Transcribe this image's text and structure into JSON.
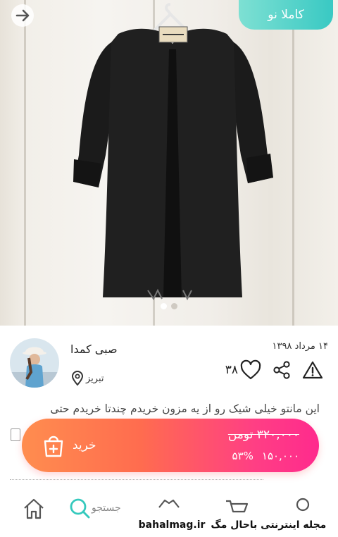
{
  "product": {
    "condition_badge": "کاملا نو",
    "description": "این مانتو خیلی شیک رو از یه مزون خریدم چندتا خریدم حتی",
    "date": "۱۴ مرداد ۱۳۹۸"
  },
  "seller": {
    "name": "صبی کمدا",
    "location": "تبریز"
  },
  "stats": {
    "likes": "۳۸"
  },
  "buy": {
    "label": "خرید",
    "price_original": "۳۲۰,۰۰۰ تومن",
    "price_final": "۱۵۰,۰۰۰",
    "discount": "۵۳%"
  },
  "nav": {
    "search_label": "جستجو"
  },
  "gallery": {
    "image_count": 2,
    "active_index": 0
  },
  "watermark": {
    "domain": "bahalmag.ir",
    "text": "مجله اینترنتی باحال مگ"
  },
  "colors": {
    "badge_gradient": [
      "#7ee0d3",
      "#39c9c3"
    ],
    "buy_gradient": [
      "#ff8d4f",
      "#ff2a8d"
    ],
    "search_accent": "#35c9bd"
  },
  "icons": {
    "back": "arrow-right-icon",
    "location": "location-pin-icon",
    "like": "heart-icon",
    "share": "share-icon",
    "report": "warning-icon",
    "buy": "shopping-bag-icon"
  }
}
